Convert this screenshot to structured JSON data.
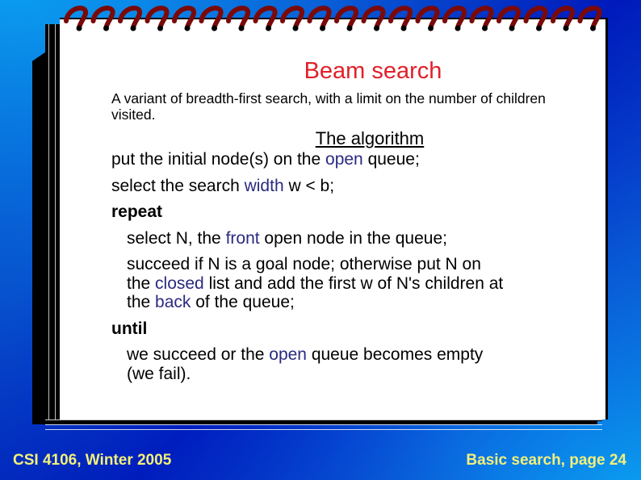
{
  "slide": {
    "title": "Beam search",
    "intro": "A variant of breadth-first search, with a limit on the number of children visited.",
    "subheading": "The algorithm",
    "steps": {
      "s1": {
        "a": "put the initial node(s) on the ",
        "hl": "open",
        "b": " queue;"
      },
      "s2": {
        "a": "select the search ",
        "hl": "width",
        "b": " w < b;"
      },
      "repeat_kw": "repeat",
      "s3": {
        "a": "select N, the ",
        "hl": "front",
        "b": " open node in the queue;"
      },
      "s4": {
        "line1": "succeed if N is a goal node; otherwise put N on",
        "a": "the ",
        "hl": "closed",
        "b": " list and add the first w of N's children at",
        "c": "the ",
        "hl2": "back",
        "d": " of the queue;"
      },
      "until_kw": "until",
      "s5": {
        "a": "we succeed or the ",
        "hl": "open",
        "b": " queue becomes empty",
        "line2": "(we fail)."
      }
    },
    "colors": {
      "title": "#e0202a",
      "highlight": "#2a2a80",
      "footer": "#f2f07a",
      "spiral": "#7a0a0a"
    }
  },
  "footer": {
    "left": "CSI 4106, Winter 2005",
    "right": "Basic search, page 24"
  }
}
